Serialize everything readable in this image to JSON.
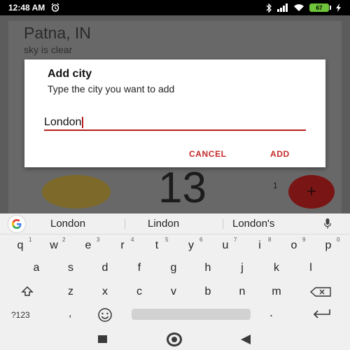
{
  "status_bar": {
    "time": "12:48 AM",
    "battery": "67"
  },
  "background_app": {
    "city": "Patna, IN",
    "condition": "sky is clear",
    "temperature": "13",
    "temp_side": "1",
    "fab_label": "+"
  },
  "dialog": {
    "title": "Add city",
    "message": "Type the city you want to add",
    "input_value": "London",
    "cancel_label": "CANCEL",
    "add_label": "ADD"
  },
  "suggestions": [
    "London",
    "Lindon",
    "London's"
  ],
  "keyboard": {
    "row1": [
      {
        "key": "q",
        "hint": "1"
      },
      {
        "key": "w",
        "hint": "2"
      },
      {
        "key": "e",
        "hint": "3"
      },
      {
        "key": "r",
        "hint": "4"
      },
      {
        "key": "t",
        "hint": "5"
      },
      {
        "key": "y",
        "hint": "6"
      },
      {
        "key": "u",
        "hint": "7"
      },
      {
        "key": "i",
        "hint": "8"
      },
      {
        "key": "o",
        "hint": "9"
      },
      {
        "key": "p",
        "hint": "0"
      }
    ],
    "row2": [
      "a",
      "s",
      "d",
      "f",
      "g",
      "h",
      "j",
      "k",
      "l"
    ],
    "row3": [
      "z",
      "x",
      "c",
      "v",
      "b",
      "n",
      "m"
    ],
    "symbols_label": "?123",
    "comma": ",",
    "period": "."
  },
  "colors": {
    "accent": "#c62828",
    "underline": "#b71c1c",
    "scrim": "#5c5c5c",
    "keyboard_bg": "#f0f0f0"
  },
  "icons": [
    "alarm-icon",
    "bluetooth-icon",
    "signal-icon",
    "wifi-icon",
    "battery-icon",
    "charging-icon",
    "google-icon",
    "mic-icon",
    "shift-icon",
    "backspace-icon",
    "emoji-icon",
    "enter-icon",
    "nav-back-icon",
    "nav-home-icon",
    "nav-recent-icon"
  ]
}
